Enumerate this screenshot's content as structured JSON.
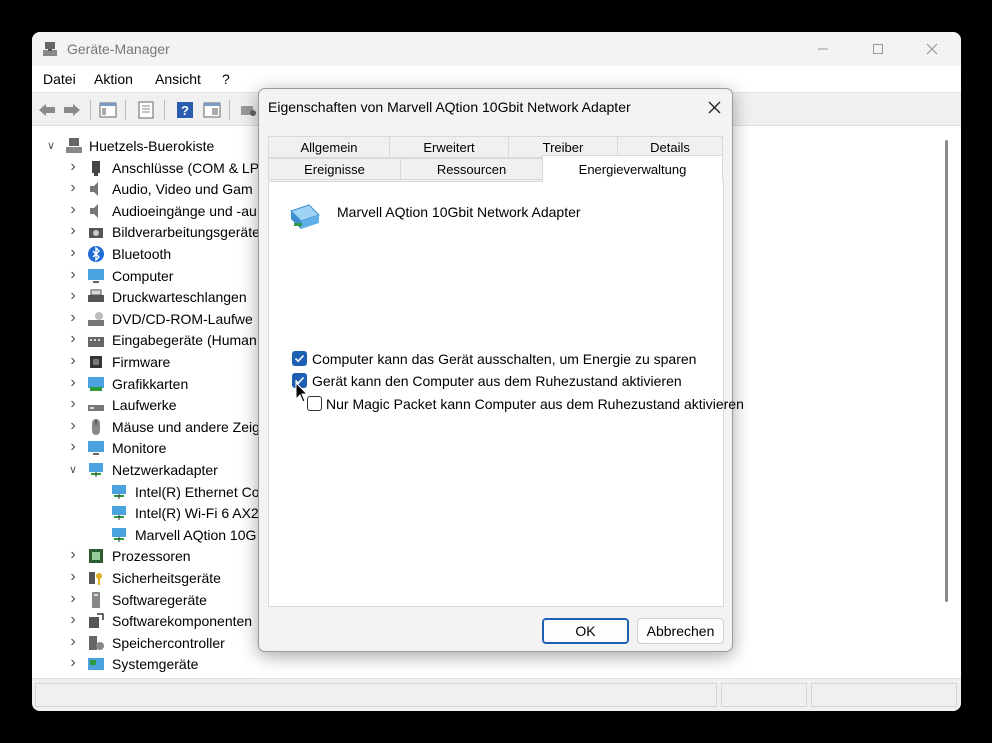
{
  "window": {
    "title": "Geräte-Manager"
  },
  "menubar": {
    "items": [
      "Datei",
      "Aktion",
      "Ansicht",
      "?"
    ]
  },
  "tree": {
    "root": "Huetzels-Buerokiste",
    "items": [
      {
        "label": "Anschlüsse (COM & LP",
        "icon": "port-icon"
      },
      {
        "label": "Audio, Video und Gam",
        "icon": "speaker-icon"
      },
      {
        "label": "Audioeingänge und -au",
        "icon": "speaker-icon"
      },
      {
        "label": "Bildverarbeitungsgeräte",
        "icon": "camera-icon"
      },
      {
        "label": "Bluetooth",
        "icon": "bluetooth-icon"
      },
      {
        "label": "Computer",
        "icon": "monitor-icon"
      },
      {
        "label": "Druckwarteschlangen",
        "icon": "printer-icon"
      },
      {
        "label": "DVD/CD-ROM-Laufwe",
        "icon": "disc-drive-icon"
      },
      {
        "label": "Eingabegeräte (Human",
        "icon": "keyboard-icon"
      },
      {
        "label": "Firmware",
        "icon": "chip-icon"
      },
      {
        "label": "Grafikkarten",
        "icon": "display-adapter-icon"
      },
      {
        "label": "Laufwerke",
        "icon": "drive-icon"
      },
      {
        "label": "Mäuse und andere Zeig",
        "icon": "mouse-icon"
      },
      {
        "label": "Monitore",
        "icon": "monitor-icon"
      },
      {
        "label": "Netzwerkadapter",
        "icon": "network-icon",
        "expanded": true
      },
      {
        "label": "Intel(R) Ethernet Co",
        "icon": "network-icon",
        "child": true
      },
      {
        "label": "Intel(R) Wi-Fi 6 AX2",
        "icon": "network-icon",
        "child": true
      },
      {
        "label": "Marvell AQtion 10G",
        "icon": "network-icon",
        "child": true
      },
      {
        "label": "Prozessoren",
        "icon": "processor-icon"
      },
      {
        "label": "Sicherheitsgeräte",
        "icon": "key-icon"
      },
      {
        "label": "Softwaregeräte",
        "icon": "software-device-icon"
      },
      {
        "label": "Softwarekomponenten",
        "icon": "component-icon"
      },
      {
        "label": "Speichercontroller",
        "icon": "storage-controller-icon"
      },
      {
        "label": "Systemgeräte",
        "icon": "system-device-icon"
      }
    ]
  },
  "dialog": {
    "title": "Eigenschaften von Marvell AQtion 10Gbit Network Adapter",
    "tabs_row1": [
      "Allgemein",
      "Erweitert",
      "Treiber",
      "Details"
    ],
    "tabs_row2": [
      "Ereignisse",
      "Ressourcen",
      "Energieverwaltung"
    ],
    "active_tab": "Energieverwaltung",
    "device_name": "Marvell AQtion 10Gbit Network Adapter",
    "options": [
      {
        "label": "Computer kann das Gerät ausschalten, um Energie zu sparen",
        "checked": true
      },
      {
        "label": "Gerät kann den Computer aus dem Ruhezustand aktivieren",
        "checked": true
      },
      {
        "label": "Nur Magic Packet kann Computer aus dem Ruhezustand aktivieren",
        "checked": false
      }
    ],
    "ok_label": "OK",
    "cancel_label": "Abbrechen"
  },
  "colors": {
    "accent": "#1d5fb0",
    "background": "#000000"
  }
}
